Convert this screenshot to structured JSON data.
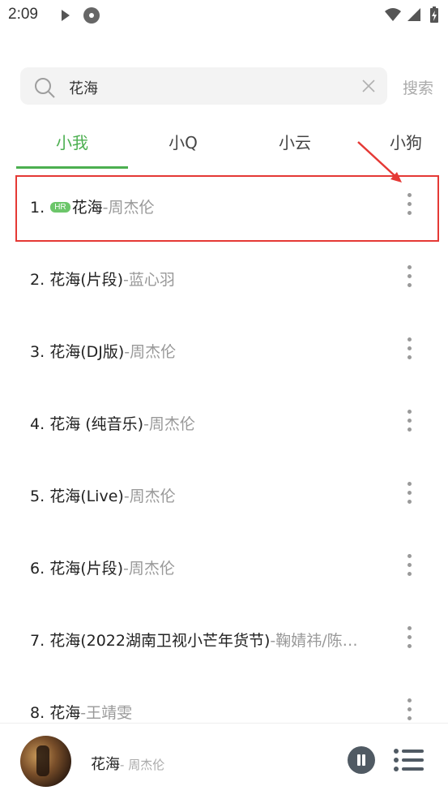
{
  "status_bar": {
    "time": "2:09",
    "icons": [
      "play-icon",
      "disc-icon",
      "wifi-icon",
      "signal-icon",
      "battery-charging-icon"
    ]
  },
  "search": {
    "query": "花海",
    "button_label": "搜索"
  },
  "tabs": [
    {
      "label": "小我",
      "active": true
    },
    {
      "label": "小Q",
      "active": false
    },
    {
      "label": "小云",
      "active": false
    },
    {
      "label": "小狗",
      "active": false
    }
  ],
  "songs": [
    {
      "index": "1.",
      "title": "花海",
      "badge": "HR",
      "artist": "周杰伦"
    },
    {
      "index": "2.",
      "title": "花海(片段)",
      "artist": "蓝心羽"
    },
    {
      "index": "3.",
      "title": "花海(DJ版)",
      "artist": "周杰伦"
    },
    {
      "index": "4.",
      "title": "花海 (纯音乐)",
      "artist": "周杰伦"
    },
    {
      "index": "5.",
      "title": "花海(Live)",
      "artist": "周杰伦"
    },
    {
      "index": "6.",
      "title": "花海(片段)",
      "artist": "周杰伦"
    },
    {
      "index": "7.",
      "title": "花海(2022湖南卫视小芒年货节)",
      "artist": "鞠婧祎/陈…"
    },
    {
      "index": "8.",
      "title": "花海",
      "artist": "王靖雯"
    }
  ],
  "now_playing": {
    "title": "花海",
    "artist": "周杰伦"
  },
  "colors": {
    "accent": "#4caf50",
    "annotation": "#e53935"
  }
}
